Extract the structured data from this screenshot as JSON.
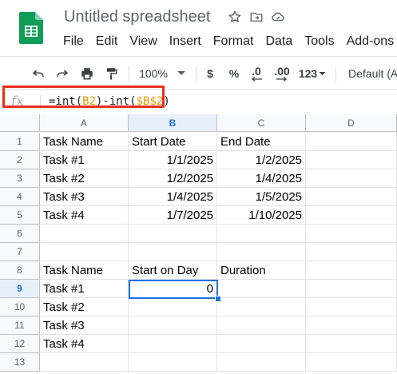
{
  "app": {
    "title": "Untitled spreadsheet",
    "menu": [
      "File",
      "Edit",
      "View",
      "Insert",
      "Format",
      "Data",
      "Tools",
      "Add-ons"
    ]
  },
  "toolbar": {
    "zoom": "100%",
    "currency": "$",
    "percent": "%",
    "decrease_decimals": ".0",
    "increase_decimals": ".00",
    "more_formats": "123",
    "font": "Default (Ar"
  },
  "formula_bar": {
    "fx_label": "fx",
    "parts": [
      "=int(",
      "B2",
      ")-int(",
      "$B$2",
      ")"
    ]
  },
  "grid": {
    "columns": [
      "A",
      "B",
      "C",
      "D"
    ],
    "active_column": "B",
    "rows": [
      {
        "num": "1",
        "cells": [
          "Task Name",
          "Start Date",
          "End Date",
          ""
        ]
      },
      {
        "num": "2",
        "cells": [
          "Task #1",
          "1/1/2025",
          "1/2/2025",
          ""
        ]
      },
      {
        "num": "3",
        "cells": [
          "Task #2",
          "1/2/2025",
          "1/4/2025",
          ""
        ]
      },
      {
        "num": "4",
        "cells": [
          "Task #3",
          "1/4/2025",
          "1/5/2025",
          ""
        ]
      },
      {
        "num": "5",
        "cells": [
          "Task #4",
          "1/7/2025",
          "1/10/2025",
          ""
        ]
      },
      {
        "num": "6",
        "cells": [
          "",
          "",
          "",
          ""
        ]
      },
      {
        "num": "7",
        "cells": [
          "",
          "",
          "",
          ""
        ]
      },
      {
        "num": "8",
        "cells": [
          "Task Name",
          "Start on Day",
          "Duration",
          ""
        ]
      },
      {
        "num": "9",
        "cells": [
          "Task #1",
          "0",
          "",
          ""
        ]
      },
      {
        "num": "10",
        "cells": [
          "Task #2",
          "",
          "",
          ""
        ]
      },
      {
        "num": "11",
        "cells": [
          "Task #3",
          "",
          "",
          ""
        ]
      },
      {
        "num": "12",
        "cells": [
          "Task #4",
          "",
          "",
          ""
        ]
      },
      {
        "num": "13",
        "cells": [
          "",
          "",
          "",
          ""
        ]
      }
    ],
    "active_row": "9",
    "numeric_cells": [
      "B2",
      "C2",
      "B3",
      "C3",
      "B4",
      "C4",
      "B5",
      "C5",
      "B9"
    ]
  },
  "colors": {
    "accent": "#1a73e8",
    "highlight_box": "#e8301c",
    "sheets_green": "#0f9d58",
    "formula_ref": "#f29900"
  }
}
